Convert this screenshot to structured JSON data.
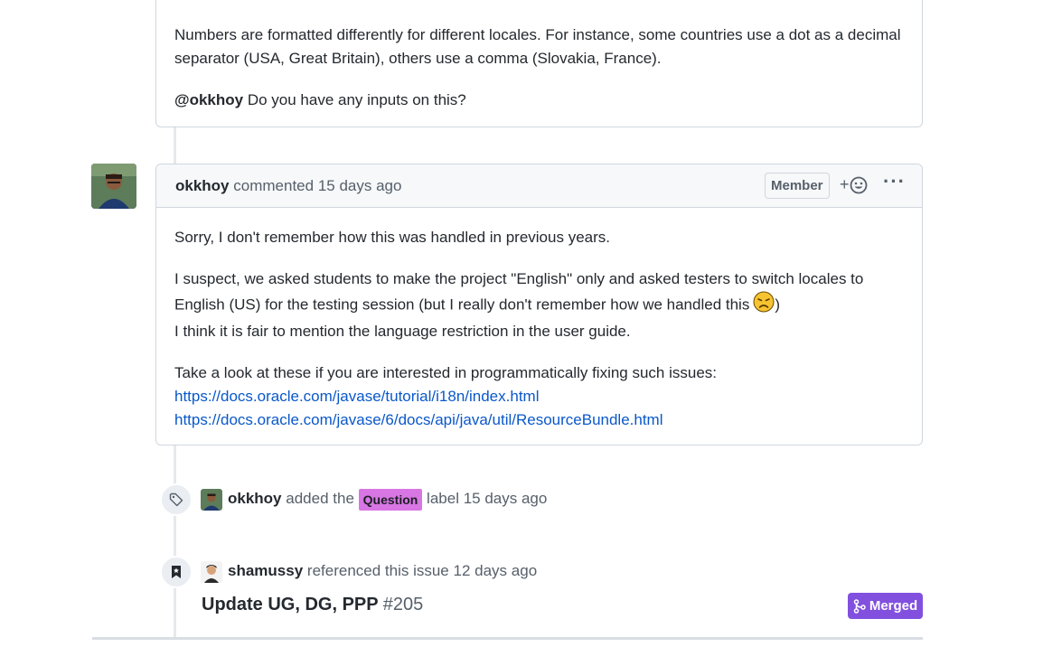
{
  "comment1": {
    "paragraph1": "Numbers are formatted differently for different locales. For instance, some countries use a dot as a decimal separator (USA, Great Britain), others use a comma (Slovakia, France).",
    "mention": "@okkhoy",
    "paragraph2_rest": " Do you have any inputs on this?"
  },
  "comment2": {
    "author": "okkhoy",
    "action": "commented",
    "time": "15 days ago",
    "role_badge": "Member",
    "reaction_plus": "+",
    "more_menu": "···",
    "p1": "Sorry, I don't remember how this was handled in previous years.",
    "p2_line1": "I suspect, we asked students to make the project \"English\" only and asked testers to switch locales to",
    "p2_line2": "English (US) for the testing session (but I really don't remember how we handled this",
    "p2_line2_end": ")",
    "p2_line3": "I think it is fair to mention the language restriction in the user guide.",
    "p3": "Take a look at these if you are interested in programmatically fixing such issues:",
    "link1": "https://docs.oracle.com/javase/tutorial/i18n/index.html",
    "link2": "https://docs.oracle.com/javase/6/docs/api/java/util/ResourceBundle.html",
    "emoji_icon": "disappointed-face"
  },
  "label_event": {
    "author": "okkhoy",
    "action": "added the",
    "label": "Question",
    "suffix": "label",
    "time": "15 days ago",
    "label_color": "#d876e3"
  },
  "reference_event": {
    "author": "shamussy",
    "action": "referenced this issue",
    "time": "12 days ago",
    "pr_title": "Update UG, DG, PPP",
    "pr_number": "#205",
    "status": "Merged",
    "status_color": "#8250df"
  }
}
